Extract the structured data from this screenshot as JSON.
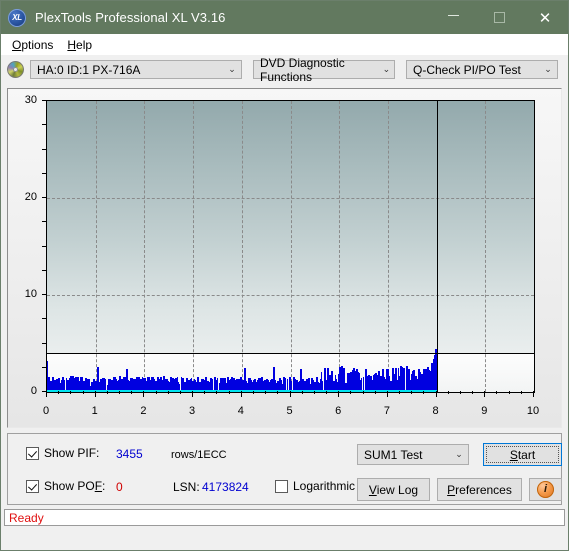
{
  "window": {
    "title": "PlexTools Professional XL V3.16",
    "icon_label": "XL",
    "minimize": "–",
    "maximize": "",
    "close": "✕"
  },
  "menubar": {
    "items": [
      {
        "label": "Options",
        "accel": "O"
      },
      {
        "label": "Help",
        "accel": "H"
      }
    ]
  },
  "toolbar": {
    "drive_combo": {
      "value": "HA:0 ID:1  PX-716A",
      "chevron": "⌄"
    },
    "function_combo": {
      "value": "DVD Diagnostic Functions",
      "chevron": "⌄"
    },
    "test_combo": {
      "value": "Q-Check PI/PO Test",
      "chevron": "⌄"
    }
  },
  "controls": {
    "show_pif_label": "Show PIF:",
    "show_pif_checked": true,
    "pif_value": "3455",
    "pif_units": "rows/1ECC",
    "show_pof_label": "Show POF:",
    "show_pof_checked": true,
    "pof_value": "0",
    "lsn_label": "LSN:",
    "lsn_value": "4173824",
    "logarithmic_label": "Logarithmic",
    "logarithmic_checked": false,
    "sum_combo": {
      "value": "SUM1 Test",
      "chevron": "⌄"
    },
    "start_button": "Start",
    "view_log_button": "View Log",
    "preferences_button": "Preferences",
    "info_button": "i"
  },
  "statusbar": {
    "text": "Ready",
    "color": "#e01010"
  },
  "colors": {
    "titlebar": "#62795f",
    "pif_bar": "#0000e0",
    "pof_line": "#00e5f0",
    "threshold_line": "#000000",
    "plot_upper_top": "#93a9ac",
    "plot_upper_bottom": "#eaeeee",
    "accent_focus": "#0078d7"
  },
  "chart_data": {
    "type": "bar",
    "title": "",
    "xlabel": "",
    "ylabel": "",
    "xlim": [
      0,
      10
    ],
    "ylim": [
      0,
      30
    ],
    "xticks": [
      0,
      1,
      2,
      3,
      4,
      5,
      6,
      7,
      8,
      9,
      10
    ],
    "yticks": [
      0,
      10,
      20,
      30
    ],
    "grid": true,
    "grid_style": "dashed",
    "legend": "none",
    "threshold": 4,
    "data_end_x": 8,
    "series": [
      {
        "name": "PIF",
        "color": "#0000e0",
        "note": "PI Failures per 1ECC, plotted across disc from 0 to 8 GB; no data beyond 8",
        "x": [
          0.01,
          0.03,
          0.05,
          0.07,
          0.1,
          0.13,
          0.16,
          0.2,
          0.23,
          0.27,
          0.3,
          0.33,
          0.36,
          0.4,
          0.43,
          0.47,
          0.5,
          0.53,
          0.57,
          0.6,
          0.63,
          0.67,
          0.7,
          0.73,
          0.76,
          0.8,
          0.83,
          0.86,
          0.9,
          0.93,
          0.97,
          1.0,
          1.04,
          1.07,
          1.1,
          1.13,
          1.17,
          1.2,
          1.24,
          1.27,
          1.3,
          1.34,
          1.37,
          1.4,
          1.44,
          1.47,
          1.5,
          1.54,
          1.58,
          1.61,
          1.65,
          1.68,
          1.72,
          1.75,
          1.79,
          1.82,
          1.86,
          1.9,
          1.93,
          1.97,
          2.0,
          2.04,
          2.08,
          2.12,
          2.16,
          2.2,
          2.24,
          2.28,
          2.32,
          2.36,
          2.4,
          2.44,
          2.48,
          2.52,
          2.56,
          2.6,
          2.64,
          2.68,
          2.72,
          2.76,
          2.8,
          2.84,
          2.88,
          2.92,
          2.96,
          3.0,
          3.05,
          3.1,
          3.14,
          3.18,
          3.22,
          3.27,
          3.31,
          3.36,
          3.4,
          3.45,
          3.5,
          3.54,
          3.58,
          3.63,
          3.67,
          3.72,
          3.76,
          3.8,
          3.85,
          3.9,
          3.94,
          3.98,
          4.02,
          4.06,
          4.1,
          4.14,
          4.18,
          4.22,
          4.26,
          4.3,
          4.34,
          4.38,
          4.42,
          4.46,
          4.5,
          4.54,
          4.58,
          4.62,
          4.66,
          4.7,
          4.74,
          4.78,
          4.82,
          4.86,
          4.9,
          4.94,
          4.98,
          5.02,
          5.06,
          5.1,
          5.14,
          5.18,
          5.22,
          5.26,
          5.3,
          5.34,
          5.38,
          5.42,
          5.46,
          5.5,
          5.54,
          5.58,
          5.62,
          5.66,
          5.7,
          5.74,
          5.78,
          5.82,
          5.86,
          5.9,
          5.94,
          5.98,
          6.02,
          6.06,
          6.1,
          6.14,
          6.18,
          6.22,
          6.26,
          6.3,
          6.34,
          6.38,
          6.42,
          6.46,
          6.5,
          6.54,
          6.58,
          6.62,
          6.66,
          6.7,
          6.74,
          6.78,
          6.82,
          6.86,
          6.9,
          6.94,
          6.98,
          7.02,
          7.06,
          7.1,
          7.14,
          7.18,
          7.22,
          7.26,
          7.3,
          7.34,
          7.38,
          7.42,
          7.46,
          7.5,
          7.54,
          7.58,
          7.62,
          7.66,
          7.7,
          7.74,
          7.78,
          7.82,
          7.86,
          7.9,
          7.94,
          7.97,
          7.99
        ],
        "values": [
          3.2,
          1.4,
          0.9,
          1.1,
          0.6,
          1.5,
          0.8,
          1.3,
          0.7,
          0.9,
          1.2,
          0.6,
          1.0,
          1.4,
          0.8,
          1.1,
          1.6,
          0.9,
          1.2,
          0.7,
          1.5,
          1.0,
          1.3,
          0.8,
          1.1,
          1.4,
          0.9,
          1.2,
          0.6,
          1.0,
          1.3,
          1.1,
          2.6,
          0.9,
          1.2,
          0.8,
          1.4,
          1.0,
          0.7,
          1.3,
          1.1,
          0.9,
          1.5,
          1.0,
          0.8,
          1.2,
          1.6,
          0.9,
          1.1,
          1.3,
          2.4,
          0.8,
          1.0,
          1.4,
          0.9,
          1.2,
          1.1,
          0.7,
          1.3,
          1.0,
          1.2,
          0.9,
          1.5,
          1.1,
          0.8,
          1.3,
          1.0,
          1.4,
          0.9,
          1.2,
          1.6,
          0.8,
          1.1,
          1.0,
          1.3,
          0.9,
          1.2,
          1.5,
          0.8,
          1.1,
          1.4,
          1.0,
          0.9,
          1.2,
          1.3,
          1.1,
          0.8,
          1.4,
          1.0,
          1.2,
          0.9,
          1.5,
          1.1,
          0.8,
          1.3,
          1.0,
          1.2,
          0.9,
          1.4,
          1.1,
          0.8,
          1.2,
          1.0,
          1.5,
          0.9,
          1.3,
          1.1,
          1.0,
          1.2,
          2.5,
          0.9,
          1.1,
          1.4,
          0.8,
          1.3,
          1.0,
          1.2,
          0.9,
          1.5,
          1.1,
          0.8,
          1.2,
          1.0,
          1.3,
          2.6,
          0.9,
          1.1,
          1.4,
          0.8,
          1.2,
          1.0,
          1.3,
          0.9,
          1.1,
          1.5,
          0.8,
          1.2,
          1.0,
          2.4,
          1.3,
          0.9,
          1.1,
          1.4,
          0.8,
          1.2,
          1.0,
          1.5,
          0.9,
          1.3,
          1.1,
          0.8,
          1.2,
          1.0,
          1.4,
          0.9,
          1.1,
          1.3,
          1.0,
          1.5,
          2.7,
          1.2,
          0.9,
          1.4,
          1.1,
          1.8,
          1.3,
          1.0,
          1.6,
          1.2,
          0.9,
          1.5,
          1.1,
          1.3,
          1.0,
          1.7,
          1.2,
          0.9,
          1.4,
          1.1,
          1.6,
          1.0,
          1.3,
          1.2,
          1.6,
          1.1,
          2.0,
          1.4,
          1.2,
          1.8,
          1.1,
          1.5,
          1.3,
          2.2,
          1.6,
          1.2,
          1.9,
          1.4,
          1.7,
          1.3,
          2.1,
          1.6,
          2.4,
          1.8,
          2.6,
          2.2,
          3.0,
          3.4,
          3.8,
          4.4
        ]
      },
      {
        "name": "POF",
        "color": "#00e5f0",
        "note": "PO Failures - flat at 0 across 0 to 8",
        "x": [
          0,
          8
        ],
        "values": [
          0,
          0
        ]
      }
    ]
  }
}
